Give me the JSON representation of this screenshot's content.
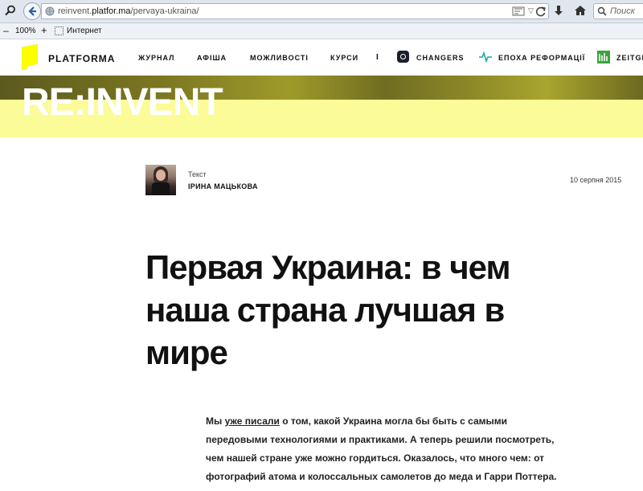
{
  "browser": {
    "url_prefix": "reinvent.",
    "url_domain": "platfor.ma",
    "url_path": "/pervaya-ukraina/",
    "search_placeholder": "Поиск",
    "zoom_minus": "–",
    "zoom_level": "100%",
    "zoom_plus": "+",
    "zone": "Интернет"
  },
  "site": {
    "logo": "PLATFORMA",
    "nav": [
      "ЖУРНАЛ",
      "АФІША",
      "МОЖЛИВОСТІ",
      "КУРСИ"
    ],
    "separator": "I",
    "partners": [
      "CHANGERS",
      "ЕПОХА РЕФОРМАЦІЇ",
      "ZEITGI"
    ],
    "brand_yellow": "#ffff00"
  },
  "banner": {
    "title": "RE:INVENT",
    "color": "#fbfb98"
  },
  "article": {
    "author_role": "Текст",
    "author_name": "ІРИНА МАЦЬКОВА",
    "date": "10 серпня 2015",
    "title": "Первая Украина: в чем наша страна лучшая в мире",
    "lead_before": "Мы ",
    "lead_link": "уже писали",
    "lead_after": " о том, какой Украина могла бы быть с самыми передовыми технологиями и практиками. А теперь решили посмотреть, чем нашей стране уже можно гордиться. Оказалось, что много чем: от фотографий атома и колоссальных самолетов до меда и Гарри Поттера."
  }
}
